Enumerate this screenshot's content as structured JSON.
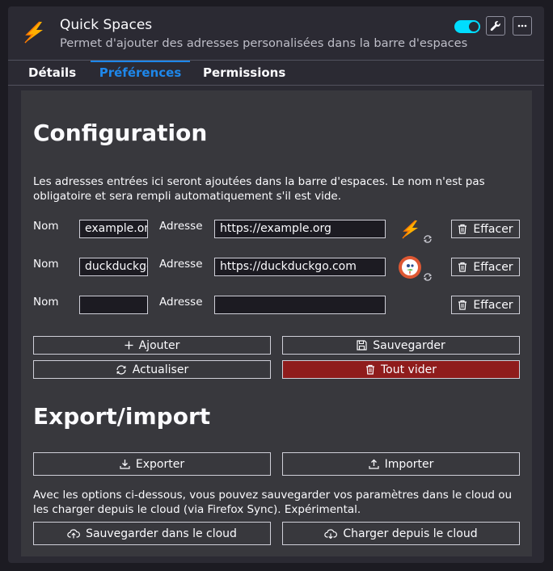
{
  "addon": {
    "title": "Quick Spaces",
    "description": "Permet d'ajouter des adresses personalisées dans la barre d'espaces",
    "enabled": true
  },
  "tabs": [
    {
      "label": "Détails"
    },
    {
      "label": "Préférences"
    },
    {
      "label": "Permissions"
    }
  ],
  "config": {
    "heading": "Configuration",
    "intro": "Les adresses entrées ici seront ajoutées dans la barre d'espaces. Le nom n'est pas obligatoire et sera rempli automatiquement s'il est vide.",
    "name_label": "Nom",
    "address_label": "Adresse",
    "delete_label": "Effacer",
    "rows": [
      {
        "name": "example.org",
        "address": "https://example.org",
        "icon": "lightning-bolt-icon"
      },
      {
        "name": "duckduckgo",
        "address": "https://duckduckgo.com",
        "icon": "duckduckgo-icon"
      },
      {
        "name": "",
        "address": "",
        "icon": ""
      }
    ],
    "add_label": "Ajouter",
    "save_label": "Sauvegarder",
    "refresh_label": "Actualiser",
    "clear_all_label": "Tout vider",
    "danger_color": "#8f1c1c"
  },
  "export": {
    "heading": "Export/import",
    "export_label": "Exporter",
    "import_label": "Importer",
    "cloud_note": "Avec les options ci-dessous, vous pouvez sauvegarder vos paramètres dans le cloud ou les charger depuis le cloud (via Firefox Sync). Expérimental.",
    "cloud_save_label": "Sauvegarder dans le cloud",
    "cloud_load_label": "Charger depuis le cloud"
  },
  "colors": {
    "accent": "#1e87ea",
    "toggle": "#00ddff",
    "bolt": "#ffb000"
  }
}
